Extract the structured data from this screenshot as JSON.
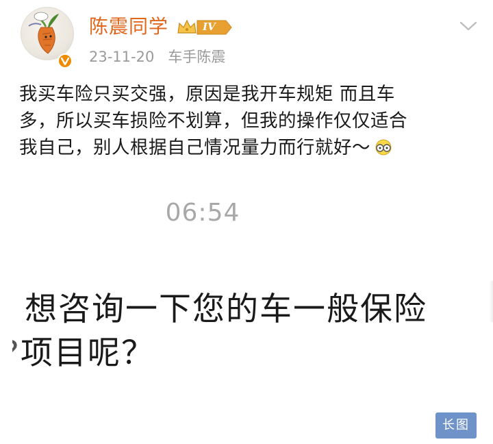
{
  "post": {
    "author": "陈震同学",
    "level": "IV",
    "date": "23-11-20",
    "source": "车手陈震",
    "lines": [
      "我买车险只买交强，原因是我开车规矩 而且车",
      "多，所以买车损险不划算，但我的操作仅仅适合",
      "我自己，别人根据自己情况量力而行就好～"
    ],
    "emoji": "glasses-face-emoji"
  },
  "screenshot": {
    "time": "06:54",
    "message_line1": "想咨询一下您的车一般保险",
    "message_line2_cut": "?",
    "message_line2": "项目呢？"
  },
  "badge": {
    "long_image": "长图"
  },
  "colors": {
    "username": "#e1661a",
    "meta": "#9a9a9a",
    "timestamp": "#a8a8a8",
    "long_image_bg": "#6f93c8",
    "verified_badge": "#f08a00",
    "level_badge": "#e8a030"
  }
}
